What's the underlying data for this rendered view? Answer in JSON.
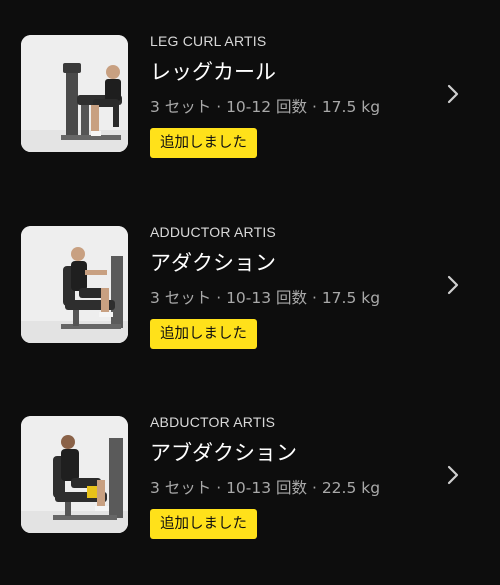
{
  "exercises": [
    {
      "name_en": "LEG CURL ARTIS",
      "name_jp": "レッグカール",
      "detail": "3 セット · 10-12 回数 · 17.5 kg",
      "status_label": "追加しました",
      "thumbnail_icon": "leg-curl-machine-photo",
      "chevron_icon": "chevron-right-icon"
    },
    {
      "name_en": "ADDUCTOR ARTIS",
      "name_jp": "アダクション",
      "detail": "3 セット · 10-13 回数 · 17.5 kg",
      "status_label": "追加しました",
      "thumbnail_icon": "adductor-machine-photo",
      "chevron_icon": "chevron-right-icon"
    },
    {
      "name_en": "ABDUCTOR ARTIS",
      "name_jp": "アブダクション",
      "detail": "3 セット · 10-13 回数 · 22.5 kg",
      "status_label": "追加しました",
      "thumbnail_icon": "abductor-machine-photo",
      "chevron_icon": "chevron-right-icon"
    }
  ],
  "colors": {
    "background": "#0d0d0d",
    "badge_background": "#ffe11a",
    "badge_text": "#111111",
    "secondary_text": "#a9a9a9"
  }
}
